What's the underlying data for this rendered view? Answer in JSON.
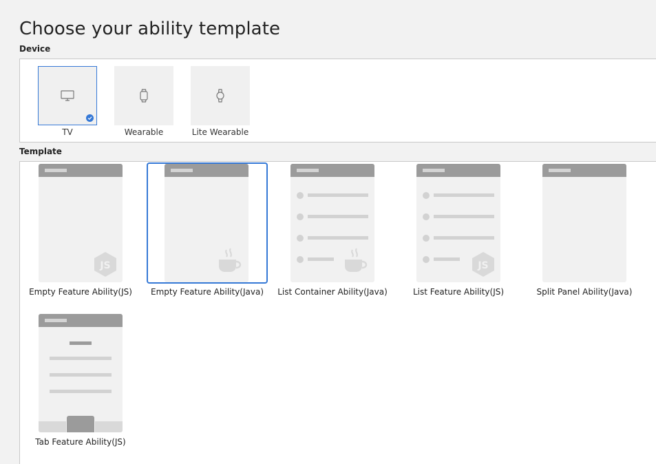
{
  "page": {
    "title": "Choose your ability template"
  },
  "device": {
    "section_label": "Device",
    "items": [
      {
        "label": "TV",
        "icon": "tv-icon",
        "selected": true
      },
      {
        "label": "Wearable",
        "icon": "watch-icon",
        "selected": false
      },
      {
        "label": "Lite Wearable",
        "icon": "lite-watch-icon",
        "selected": false
      }
    ]
  },
  "template": {
    "section_label": "Template",
    "items": [
      {
        "label": "Empty Feature Ability(JS)",
        "style": "empty",
        "badge": "js-logo-icon",
        "selected": false
      },
      {
        "label": "Empty Feature Ability(Java)",
        "style": "empty",
        "badge": "java-cup-icon",
        "selected": true
      },
      {
        "label": "List Container Ability(Java)",
        "style": "list",
        "badge": "java-cup-icon",
        "selected": false
      },
      {
        "label": "List Feature Ability(JS)",
        "style": "list",
        "badge": "js-logo-icon",
        "selected": false
      },
      {
        "label": "Split Panel Ability(Java)",
        "style": "empty",
        "badge": "",
        "selected": false
      },
      {
        "label": "Tab Feature Ability(JS)",
        "style": "tab",
        "badge": "",
        "selected": false
      }
    ]
  },
  "colors": {
    "accent": "#3478d6",
    "card_header": "#9b9b9b",
    "card_body": "#f1f1f1"
  }
}
